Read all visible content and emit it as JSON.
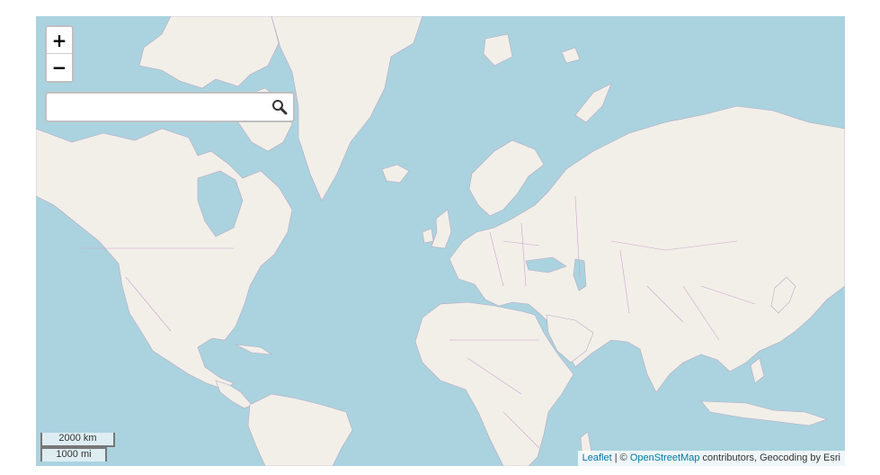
{
  "map": {
    "water_color": "#aad3df",
    "land_color": "#f2efe9",
    "border_color": "#c9a6cf"
  },
  "zoom": {
    "in_label": "+",
    "out_label": "−"
  },
  "search": {
    "value": "",
    "placeholder": "",
    "icon": "search-icon"
  },
  "scale": {
    "metric": "2000 km",
    "imperial": "1000 mi"
  },
  "attribution": {
    "leaflet": "Leaflet",
    "separator": " | © ",
    "osm": "OpenStreetMap",
    "suffix": " contributors, Geocoding by Esri"
  }
}
